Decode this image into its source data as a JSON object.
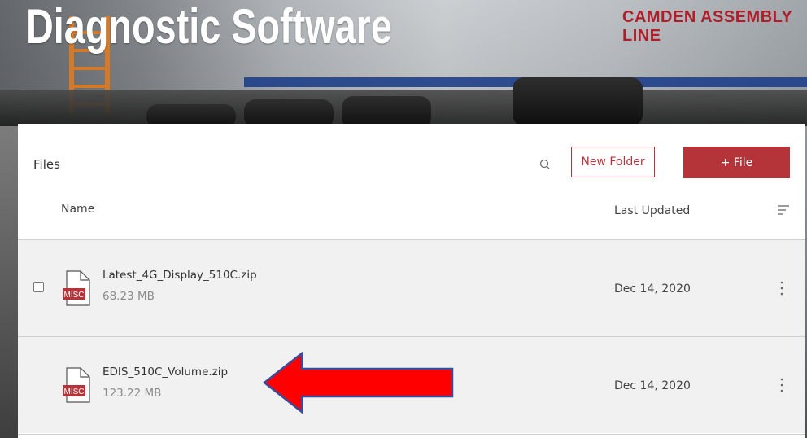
{
  "header": {
    "title": "Diagnostic Software",
    "background_sign": "CAMDEN ASSEMBLY LINE"
  },
  "toolbar": {
    "files_label": "Files",
    "search_icon": "search-icon",
    "new_folder_label": "New Folder",
    "add_file_label": "+ File"
  },
  "table": {
    "columns": {
      "name": "Name",
      "updated": "Last Updated"
    },
    "sort_icon": "sort-lines-icon",
    "rows": [
      {
        "name": "Latest_4G_Display_510C.zip",
        "size": "68.23 MB",
        "updated": "Dec 14, 2020",
        "type_badge": "MISC"
      },
      {
        "name": "EDIS_510C_Volume.zip",
        "size": "123.22 MB",
        "updated": "Dec 14, 2020",
        "type_badge": "MISC"
      }
    ]
  },
  "annotation": {
    "arrow_icon": "red-arrow-left-icon",
    "arrow_color": "#ff0000",
    "arrow_outline": "#3b4a9a"
  },
  "colors": {
    "accent": "#b4343a",
    "row_alt": "#f1f1f1",
    "badge": "#b4343a"
  }
}
